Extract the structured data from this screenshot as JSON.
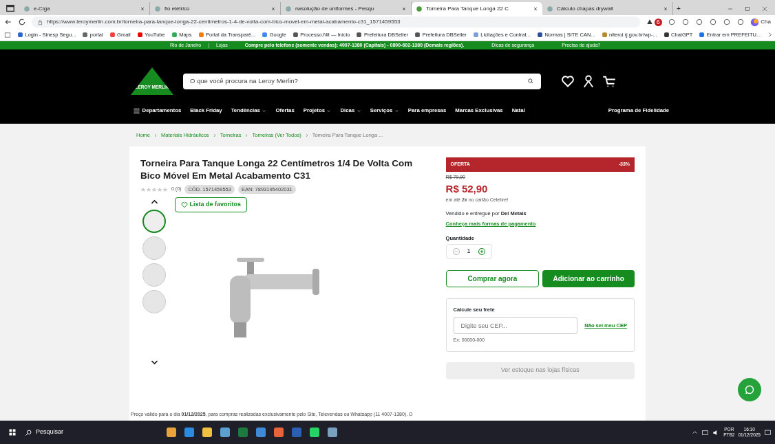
{
  "browser": {
    "tabs": [
      {
        "title": "e-Ciga",
        "selected": false
      },
      {
        "title": "fio elétrico",
        "selected": false
      },
      {
        "title": "rwsolução de uniformes - Pesqu",
        "selected": false
      },
      {
        "title": "Torneira Para Tanque Longa 22 C",
        "selected": true
      },
      {
        "title": "Cálculo chapas drywall",
        "selected": false
      }
    ],
    "new_tab": "+",
    "url": "https://www.leroymerlin.com.br/torneira-para-tanque-longa-22-centimetros-1-4-de-volta-com-bico-movel-em-metal-acabamento-c31_1571459553",
    "extension_badge": "6",
    "copilot_label": "Cha",
    "bookmarks": [
      "Login - Sinesp Segu...",
      "portal",
      "Gmail",
      "YouTube",
      "Maps",
      "Portal da Transparê...",
      "Google",
      "Processo.Nit — Início",
      "Prefeitura DBSeller",
      "Prefeitura DBSeller",
      "Licitações e Contrat...",
      "Normas | SITE CAN...",
      "niteroi.rj.gov.br/wp-...",
      "ChatGPT",
      "Entrar em PREFEITU..."
    ]
  },
  "topbar": {
    "city": "Rio de Janeiro",
    "separator": "|",
    "stores": "Lojas",
    "phone": "Compre pelo telefone (somente vendas): 4007-1380 (Capitais) - 0800-602-1380 (Demais regiões).",
    "safety": "Dicas de segurança",
    "help": "Precisa de ajuda?"
  },
  "header": {
    "logo": "LEROY MERLIN",
    "search": {
      "placeholder": "O que você procura na Leroy Merlin?"
    },
    "nav": [
      {
        "label": "Departamentos",
        "has_menu": false
      },
      {
        "label": "Black Friday",
        "has_menu": false
      },
      {
        "label": "Tendências",
        "has_menu": true
      },
      {
        "label": "Ofertas",
        "has_menu": false
      },
      {
        "label": "Projetos",
        "has_menu": true
      },
      {
        "label": "Dicas",
        "has_menu": true
      },
      {
        "label": "Serviços",
        "has_menu": true
      },
      {
        "label": "Para empresas",
        "has_menu": false
      },
      {
        "label": "Marcas Exclusivas",
        "has_menu": false
      },
      {
        "label": "Natal",
        "has_menu": false
      }
    ],
    "loyalty": "Programa de Fidelidade"
  },
  "breadcrumb": [
    "Home",
    "Materiais Hidráulicos",
    "Torneiras",
    "Torneiras (Ver Todos)",
    "Torneira Para Tanque Longa ..."
  ],
  "product": {
    "title": "Torneira Para Tanque Longa 22 Centímetros 1/4 De Volta Com Bico Móvel Em Metal Acabamento C31",
    "stars": 0,
    "reviews": "0 (0)",
    "code": "CÓD. 1571459553",
    "ean": "EAN: 7893195402031",
    "favorite": "Lista de favoritos",
    "thumbnails": [
      {
        "selected": true
      },
      {
        "selected": false
      },
      {
        "selected": false
      },
      {
        "selected": false
      }
    ],
    "note": "Preço válido para o dia **01/12/2025**, para compras realizadas exclusivamente pelo Site, Televendas ou Whatsapp (11 4007-1380). O"
  },
  "buy": {
    "offer": "OFERTA",
    "discount": "-33%",
    "old_price": "R$ 79,90",
    "price": "R$ 52,90",
    "installments": "em até **2x** no cartão Celebre!",
    "seller": "Vendido e entregue por **Del Metais**",
    "payment_link": "Conheça mais formas de pagamento",
    "quantity_label": "Quantidade",
    "quantity": "1",
    "buy_now": "Comprar agora",
    "add_to_cart": "Adicionar ao carrinho",
    "shipping_title": "Calcule seu frete",
    "cep": {
      "placeholder": "Digite seu CEP..."
    },
    "cep_help": "Não sei meu CEP",
    "cep_example": "Ex: 00000-000",
    "stock": "Ver estoque nas lojas físicas"
  },
  "taskbar": {
    "search": "Pesquisar",
    "lang1": "POR",
    "lang2": "PTB2",
    "time": "16:10",
    "date": "01/12/2025"
  }
}
